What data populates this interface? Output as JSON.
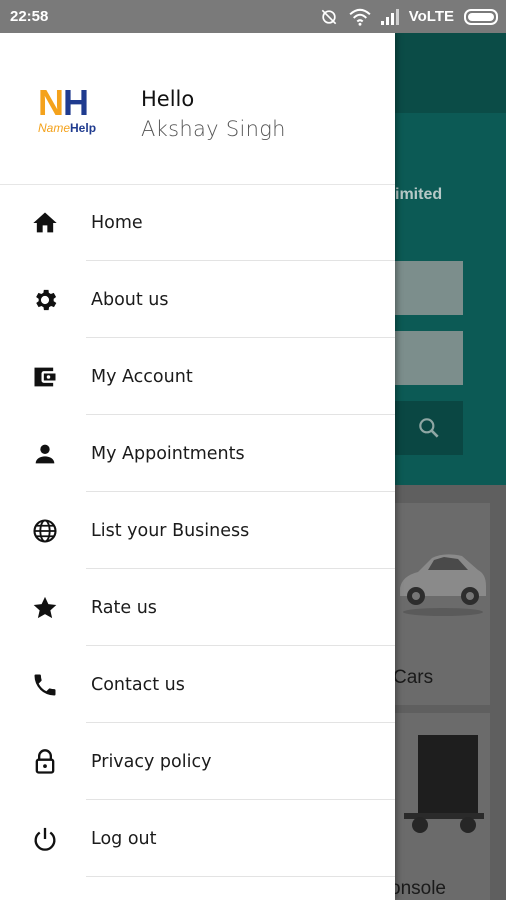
{
  "status_bar": {
    "time": "22:58",
    "network": "VoLTE",
    "icons": [
      "sync-off-icon",
      "wifi-icon",
      "signal-icon",
      "battery-icon"
    ]
  },
  "background": {
    "partial_text_limited": "imited",
    "partial_text_cars": "Cars",
    "partial_text_console": "onsole"
  },
  "drawer": {
    "logo": {
      "letters_n": "N",
      "letters_h": "H",
      "tag_a": "Name",
      "tag_b": "Help"
    },
    "greeting": "Hello",
    "user_name": "Akshay Singh",
    "items": [
      {
        "label": "Home",
        "icon": "home-icon"
      },
      {
        "label": "About us",
        "icon": "gear-icon"
      },
      {
        "label": "My Account",
        "icon": "wallet-icon"
      },
      {
        "label": "My Appointments",
        "icon": "person-icon"
      },
      {
        "label": "List your Business",
        "icon": "globe-icon"
      },
      {
        "label": "Rate us",
        "icon": "star-icon"
      },
      {
        "label": "Contact us",
        "icon": "phone-icon"
      },
      {
        "label": "Privacy policy",
        "icon": "lock-icon"
      },
      {
        "label": "Log out",
        "icon": "power-icon"
      }
    ]
  },
  "colors": {
    "brand_orange": "#f4a21c",
    "brand_blue": "#1f3b8f",
    "teal": "#0c5a55"
  }
}
